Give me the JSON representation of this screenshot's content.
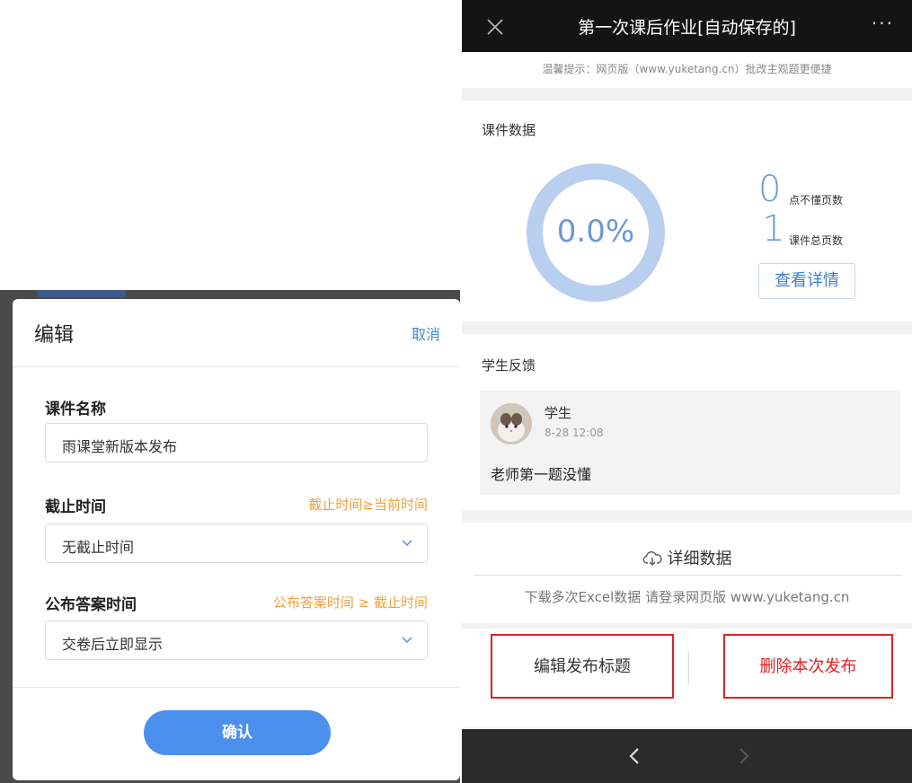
{
  "dialog": {
    "title": "编辑",
    "cancel_label": "取消",
    "fields": [
      {
        "label": "课件名称",
        "hint": "",
        "value": "雨课堂新版本发布"
      },
      {
        "label": "截止时间",
        "hint": "截止时间≥当前时间",
        "value": "无截止时间"
      },
      {
        "label": "公布答案时间",
        "hint": "公布答案时间 ≥ 截止时间",
        "value": "交卷后立即显示"
      }
    ],
    "confirm_label": "确认"
  },
  "phone": {
    "title": "第一次课后作业[自动保存的]",
    "more_label": "···",
    "tip": "温馨提示：网页版（www.yuketang.cn）批改主观题更便捷",
    "courseware": {
      "section_title": "课件数据",
      "ring_value": "0.0%",
      "ring_fraction": 0,
      "not_understood_count": "0",
      "not_understood_label": "点不懂页数",
      "total_pages_count": "1",
      "total_pages_label": "课件总页数",
      "details_button": "查看详情"
    },
    "feedback": {
      "section_title": "学生反馈",
      "name": "学生",
      "time": "8-28 12:08",
      "text": "老师第一题没懂"
    },
    "detail_data_label": "详细数据",
    "download_tip": "下载多次Excel数据 请登录网页版 www.yuketang.cn",
    "edit_title_button": "编辑发布标题",
    "delete_button": "删除本次发布"
  },
  "colors": {
    "accent_blue": "#4c90ee",
    "hint_orange": "#f0a13c",
    "ring_blue": "#b9cff0",
    "highlight_red": "#e02020"
  }
}
